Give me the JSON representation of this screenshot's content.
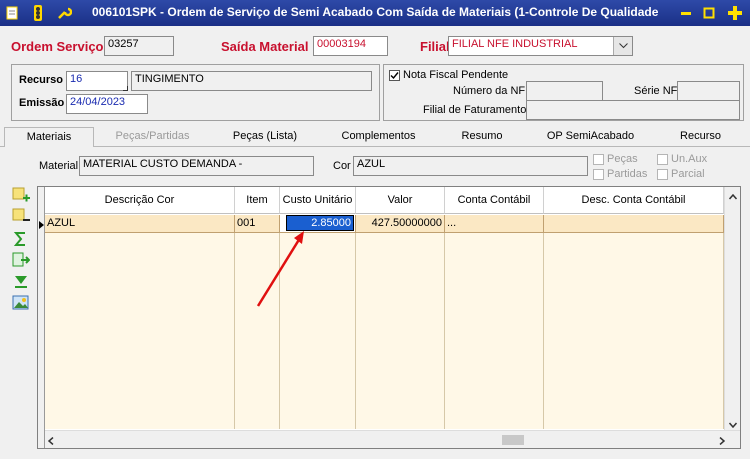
{
  "window": {
    "title": "006101SPK - Ordem de Serviço de Semi Acabado Com Saída de Materiais (1-Controle De Qualidade",
    "controls": [
      "minimize",
      "maximize",
      "close"
    ]
  },
  "header": {
    "ordem_label": "Ordem Serviço",
    "ordem_value": "03257",
    "saida_label": "Saída Material",
    "saida_value": "00003194",
    "filial_label": "Filial",
    "filial_value": "FILIAL NFE INDUSTRIAL"
  },
  "recurso": {
    "recurso_label": "Recurso",
    "recurso_value": "16",
    "recurso_desc": "TINGIMENTO",
    "emissao_label": "Emissão",
    "emissao_value": "24/04/2023"
  },
  "nota": {
    "checkbox_label": "Nota Fiscal Pendente",
    "numero_nf_label": "Número da NF",
    "numero_nf_value": "",
    "serie_nf_label": "Série NF",
    "serie_nf_value": "",
    "filial_fat_label": "Filial de Faturamento",
    "filial_fat_value": ""
  },
  "tabs": [
    "Materiais",
    "Peças/Partidas",
    "Peças (Lista)",
    "Complementos",
    "Resumo",
    "OP SemiAcabado",
    "Recurso"
  ],
  "material": {
    "material_label": "Material",
    "material_value": "MATERIAL CUSTO DEMANDA -",
    "cor_label": "Cor",
    "cor_value": "AZUL",
    "pecas_label": "Peças",
    "partidas_label": "Partidas",
    "unaux_label": "Un.Aux",
    "parcial_label": "Parcial"
  },
  "toolbar_icons": [
    "add-row-icon",
    "remove-row-icon",
    "sum-icon",
    "export-icon",
    "download-icon",
    "image-icon"
  ],
  "grid": {
    "columns": [
      "Descrição Cor",
      "Item",
      "Custo Unitário",
      "Valor",
      "Conta Contábil",
      "Desc. Conta Contábil"
    ],
    "rows": [
      [
        "AZUL",
        "001",
        "2.85000",
        "427.50000000",
        "...",
        ""
      ]
    ]
  },
  "colors": {
    "title_bar": "#1f3a93",
    "label_red": "#c8102e",
    "row_highlight": "#fbe8c4",
    "selection": "#1a5fd0",
    "arrow": "#e01010"
  }
}
